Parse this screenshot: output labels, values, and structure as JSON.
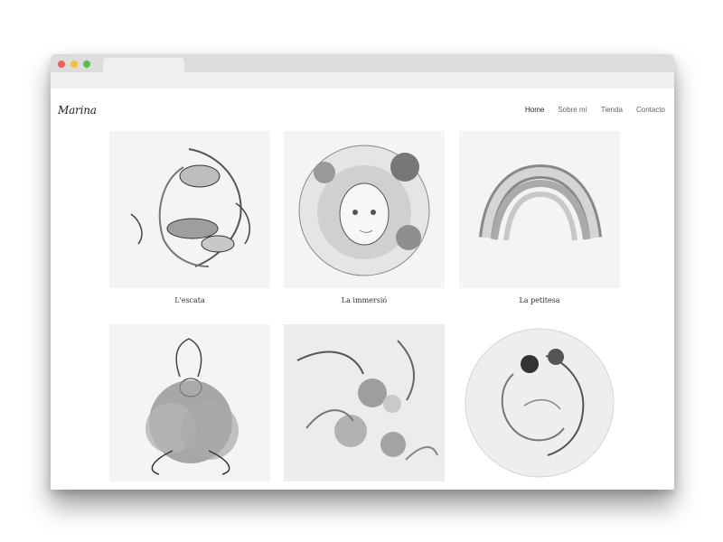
{
  "site": {
    "logo": "Marina",
    "nav": [
      {
        "label": "Home",
        "active": true
      },
      {
        "label": "Sobre mí",
        "active": false
      },
      {
        "label": "Tienda",
        "active": false
      },
      {
        "label": "Contacto",
        "active": false
      }
    ]
  },
  "gallery": {
    "items": [
      {
        "title": "L'escata"
      },
      {
        "title": "La immersió"
      },
      {
        "title": "La petitesa"
      },
      {
        "title": ""
      },
      {
        "title": ""
      },
      {
        "title": ""
      }
    ]
  },
  "colors": {
    "window_red": "#f35f55",
    "window_yellow": "#f7c133",
    "window_green": "#55c146",
    "chrome": "#dcdcdc"
  }
}
